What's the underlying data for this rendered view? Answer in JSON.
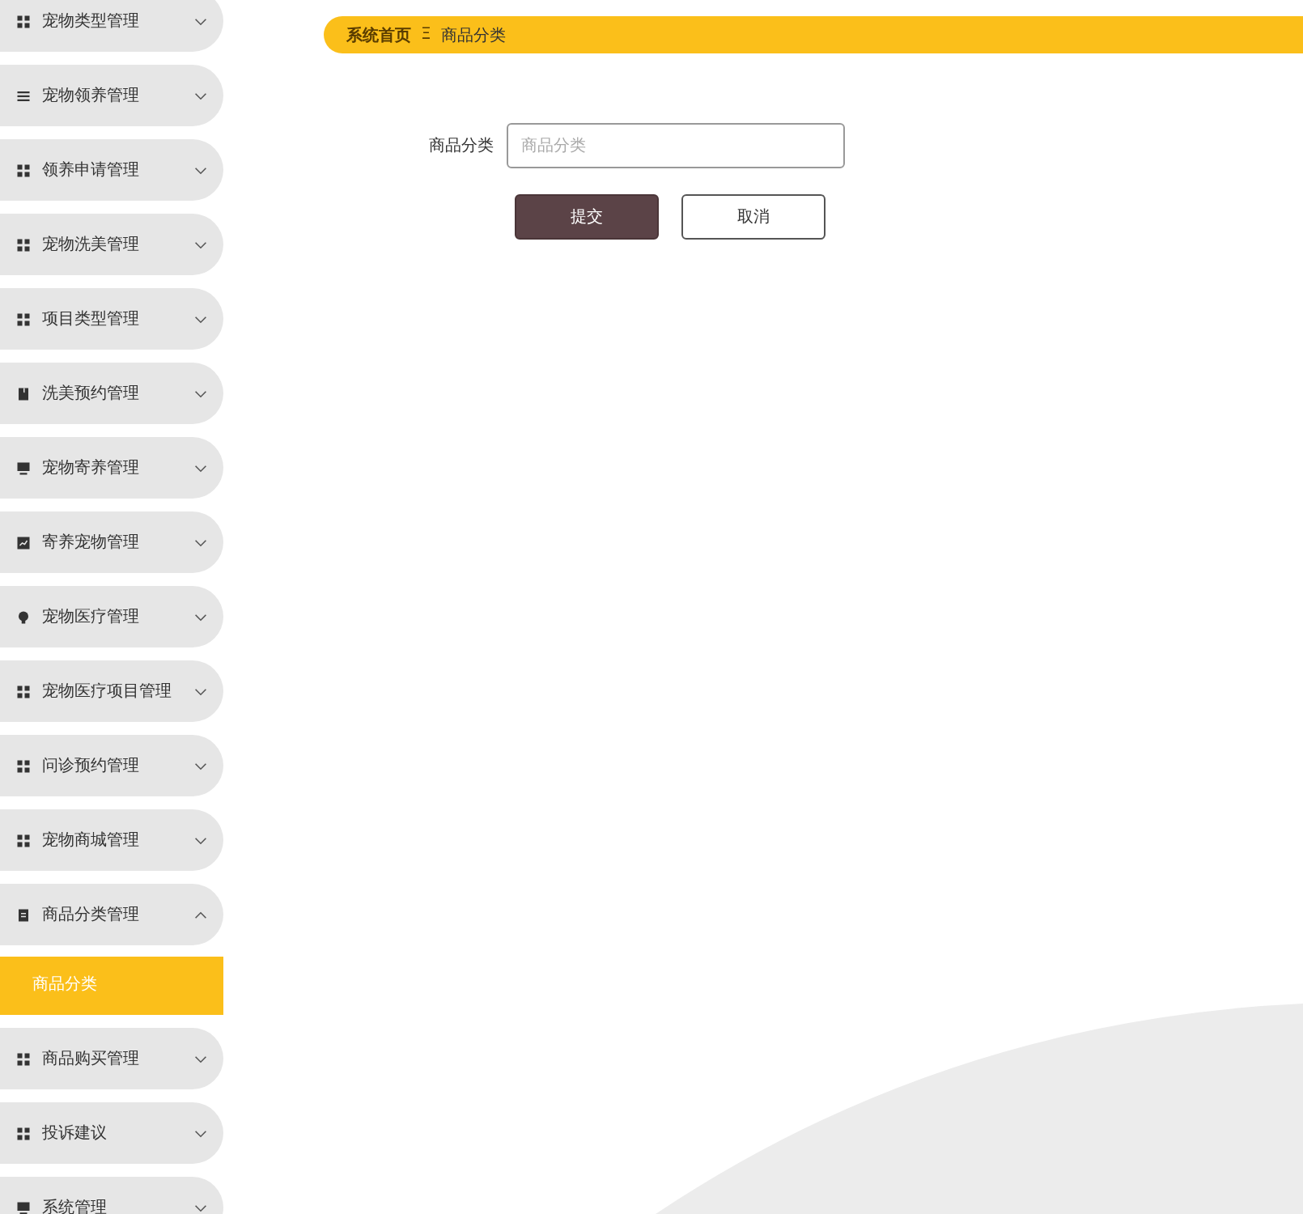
{
  "sidebar": {
    "items": [
      {
        "label": "宠物类型管理",
        "kind": "grid",
        "expanded": false
      },
      {
        "label": "宠物领养管理",
        "kind": "list",
        "expanded": false
      },
      {
        "label": "领养申请管理",
        "kind": "grid",
        "expanded": false
      },
      {
        "label": "宠物洗美管理",
        "kind": "grid",
        "expanded": false
      },
      {
        "label": "项目类型管理",
        "kind": "grid",
        "expanded": false
      },
      {
        "label": "洗美预约管理",
        "kind": "book",
        "expanded": false
      },
      {
        "label": "宠物寄养管理",
        "kind": "monitor",
        "expanded": false
      },
      {
        "label": "寄养宠物管理",
        "kind": "chart",
        "expanded": false
      },
      {
        "label": "宠物医疗管理",
        "kind": "bulb",
        "expanded": false
      },
      {
        "label": "宠物医疗项目管理",
        "kind": "grid",
        "expanded": false
      },
      {
        "label": "问诊预约管理",
        "kind": "grid",
        "expanded": false
      },
      {
        "label": "宠物商城管理",
        "kind": "grid",
        "expanded": false
      },
      {
        "label": "商品分类管理",
        "kind": "doc",
        "expanded": true,
        "children": [
          {
            "label": "商品分类",
            "selected": true
          }
        ]
      },
      {
        "label": "商品购买管理",
        "kind": "grid",
        "expanded": false
      },
      {
        "label": "投诉建议",
        "kind": "grid",
        "expanded": false
      },
      {
        "label": "系统管理",
        "kind": "monitor",
        "expanded": false
      }
    ]
  },
  "breadcrumb": {
    "home": "系统首页",
    "separator": "Ξ",
    "current": "商品分类"
  },
  "form": {
    "fields": [
      {
        "label": "商品分类",
        "placeholder": "商品分类"
      }
    ],
    "buttons": [
      {
        "label": "提交",
        "kind": "primary"
      },
      {
        "label": "取消",
        "kind": "secondary"
      }
    ]
  }
}
